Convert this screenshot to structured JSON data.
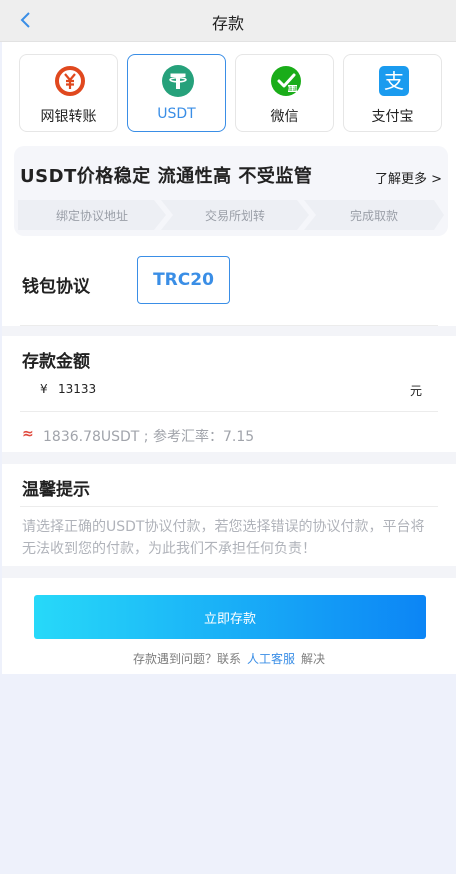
{
  "header": {
    "title": "存款"
  },
  "methods": [
    {
      "label": "网银转账",
      "icon": "bank-transfer-icon",
      "active": false
    },
    {
      "label": "USDT",
      "icon": "tether-icon",
      "active": true
    },
    {
      "label": "微信",
      "icon": "wechat-icon",
      "active": false
    },
    {
      "label": "支付宝",
      "icon": "alipay-icon",
      "active": false
    }
  ],
  "banner": {
    "title": "USDT价格稳定 流通性高 不受监管",
    "more": "了解更多 >",
    "steps": [
      "绑定协议地址",
      "交易所划转",
      "完成取款"
    ]
  },
  "protocol": {
    "label": "钱包协议",
    "selected": "TRC20"
  },
  "amount": {
    "title": "存款金额",
    "currency": "¥",
    "value": "13133",
    "unit": "元",
    "rate_text": "1836.78USDT ; 参考汇率：7.15"
  },
  "tips": {
    "title": "温馨提示",
    "text": "请选择正确的USDT协议付款，若您选择错误的协议付款，平台将无法收到您的付款，为此我们不承担任何负责！"
  },
  "submit": {
    "label": "立即存款"
  },
  "help": {
    "prefix": "存款遇到问题？联系",
    "link": "人工客服",
    "suffix": "解决"
  },
  "colors": {
    "accent": "#3a8ee6",
    "bank": "#e0481e",
    "tether": "#26a17b",
    "wechat": "#1aad19",
    "alipay": "#1a9bef"
  }
}
